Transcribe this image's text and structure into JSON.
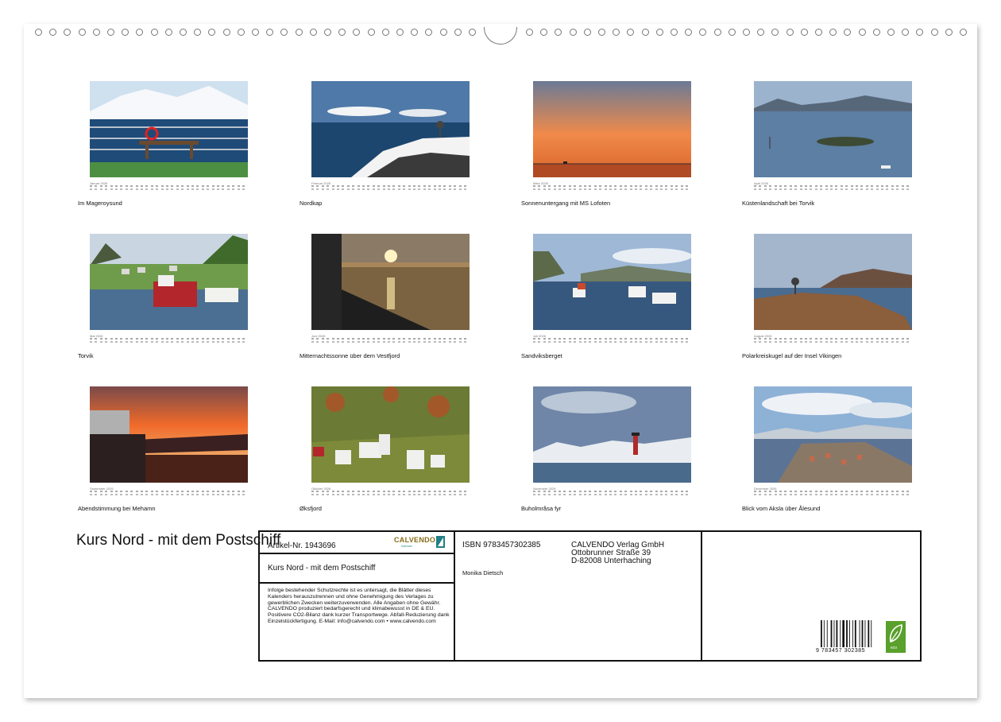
{
  "months": [
    {
      "label": "Januar 2026",
      "caption": "Im Mageroysund"
    },
    {
      "label": "Februar 2026",
      "caption": "Nordkap"
    },
    {
      "label": "März 2026",
      "caption": "Sonnenuntergang mit MS Lofoten"
    },
    {
      "label": "April 2026",
      "caption": "Küstenlandschaft bei Torvik"
    },
    {
      "label": "Mai 2026",
      "caption": "Torvik"
    },
    {
      "label": "Juni 2026",
      "caption": "Mitternachtssonne über dem Vestfjord"
    },
    {
      "label": "Juli 2026",
      "caption": "Sandviksberget"
    },
    {
      "label": "August 2026",
      "caption": "Polarkreiskugel auf der Insel Vikingen"
    },
    {
      "label": "September 2026",
      "caption": "Abendstimmung bei Mehamn"
    },
    {
      "label": "Oktober 2026",
      "caption": "Øksfjord"
    },
    {
      "label": "November 2026",
      "caption": "Buholmråsa fyr"
    },
    {
      "label": "Dezember 2026",
      "caption": "Blick vom Aksla über Ålesund"
    }
  ],
  "title": "Kurs Nord - mit dem Postschiff",
  "info": {
    "article_no": "Artikel-Nr. 1943696",
    "logo": "CALVENDO",
    "logo_sub": "Kalender",
    "subtitle": "Kurs Nord - mit dem Postschiff",
    "disclaimer": "Infolge bestehender Schutzrechte ist es untersagt, die Blätter dieses Kalenders herauszutrennen und ohne Genehmigung des Verlages zu gewerblichen Zwecken weiterzuverwenden. Alle Angaben ohne Gewähr. CALVENDO produziert bedarfsgerecht und klimabewusst in DE & EU. Positivere CO2-Bilanz dank kurzer Transportwege. Abfall-Reduzierung dank Einzelstückfertigung. E-Mail: info@calvendo.com • www.calvendo.com",
    "isbn": "ISBN 9783457302385",
    "author": "Monika Dietsch",
    "publisher_name": "CALVENDO Verlag GmbH",
    "publisher_street": "Ottobrunner Straße 39",
    "publisher_city": "D-82008 Unterhaching",
    "barcode_digits": "9 783457 302385",
    "eco_label": "eco"
  },
  "colors": {
    "frame": "#111111",
    "logo_gold": "#8a6d1a",
    "logo_teal": "#2a8a8a",
    "eco_green": "#5aa02c"
  }
}
